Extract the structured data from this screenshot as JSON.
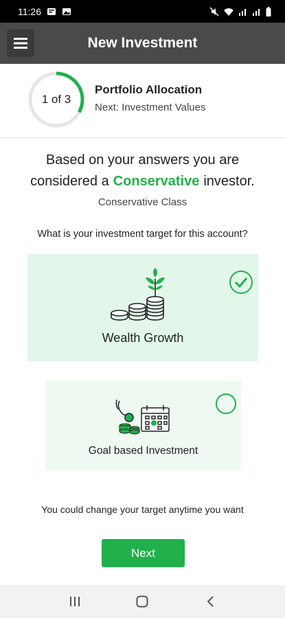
{
  "status_bar": {
    "time": "11:26"
  },
  "app_bar": {
    "title": "New Investment"
  },
  "step": {
    "counter": "1 of 3",
    "progress": 0.33,
    "title": "Portfolio Allocation",
    "next": "Next: Investment Values"
  },
  "result": {
    "line1": "Based on your answers you are",
    "prefix": "considered a",
    "profile": "Conservative",
    "suffix": "investor.",
    "class_label": "Conservative Class"
  },
  "question": "What is your investment target for this account?",
  "options": [
    {
      "label": "Wealth Growth",
      "selected": true,
      "icon": "coins-plant-icon"
    },
    {
      "label": "Goal based Investment",
      "selected": false,
      "icon": "goal-calendar-icon"
    }
  ],
  "footer_note": "You could change your target anytime you want",
  "next_button": "Next",
  "colors": {
    "accent": "#21b04b",
    "app_bar": "#4a4a4a",
    "card_selected": "#e3f6ea",
    "card": "#eef9f2"
  }
}
